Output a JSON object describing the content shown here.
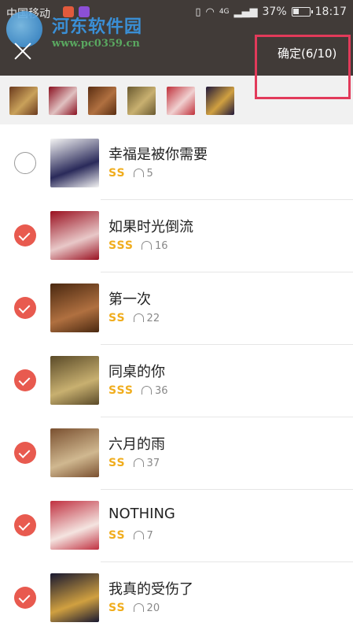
{
  "status_bar": {
    "carrier": "中国移动",
    "network": "4G",
    "battery": "37%",
    "battery_level": 0.37,
    "time": "18:17"
  },
  "watermark": {
    "title": "河东软件园",
    "url": "www.pc0359.cn"
  },
  "header": {
    "confirm_label": "确定(6/10)",
    "accent_color": "#e85a4f",
    "highlight_color": "#e23a5a"
  },
  "selected_thumbnails": [
    {
      "colors": [
        "#6b3a1e",
        "#c9a15a"
      ]
    },
    {
      "colors": [
        "#8a1020",
        "#e0c0c0"
      ]
    },
    {
      "colors": [
        "#5a2e12",
        "#b07040"
      ]
    },
    {
      "colors": [
        "#6a5a30",
        "#c8b070"
      ]
    },
    {
      "colors": [
        "#c0303a",
        "#f0d0d0"
      ]
    },
    {
      "colors": [
        "#20183a",
        "#d0a040"
      ]
    }
  ],
  "songs": [
    {
      "title": "幸福是被你需要",
      "quality": "SS",
      "plays": "5",
      "checked": false,
      "cover": [
        "#f4f4f4",
        "#2a2a5a"
      ]
    },
    {
      "title": "如果时光倒流",
      "quality": "SSS",
      "plays": "16",
      "checked": true,
      "cover": [
        "#9a1020",
        "#e8c8c8"
      ]
    },
    {
      "title": "第一次",
      "quality": "SS",
      "plays": "22",
      "checked": true,
      "cover": [
        "#4a2810",
        "#b07040"
      ]
    },
    {
      "title": "同桌的你",
      "quality": "SSS",
      "plays": "36",
      "checked": true,
      "cover": [
        "#5a4a28",
        "#c8b070"
      ]
    },
    {
      "title": "六月的雨",
      "quality": "SS",
      "plays": "37",
      "checked": true,
      "cover": [
        "#7a5030",
        "#d0b890"
      ]
    },
    {
      "title": "NOTHING",
      "quality": "SS",
      "plays": "7",
      "checked": true,
      "cover": [
        "#c03040",
        "#f4e4e0"
      ]
    },
    {
      "title": "我真的受伤了",
      "quality": "SS",
      "plays": "20",
      "checked": true,
      "cover": [
        "#181830",
        "#d0a040"
      ]
    }
  ]
}
